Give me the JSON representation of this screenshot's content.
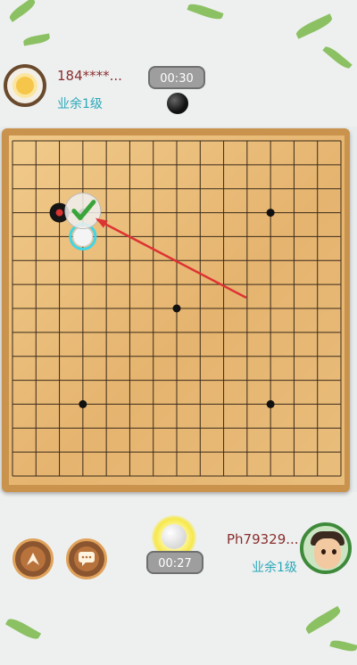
{
  "top_player": {
    "name": "184****...",
    "level": "业余1级",
    "timer": "00:30",
    "stone": "black"
  },
  "bottom_player": {
    "name": "Ph79329...",
    "level": "业余1级",
    "timer": "00:27",
    "stone": "white"
  },
  "board": {
    "size": 15,
    "star_points": [
      [
        3,
        3
      ],
      [
        3,
        11
      ],
      [
        7,
        7
      ],
      [
        11,
        3
      ],
      [
        11,
        11
      ]
    ],
    "stones": [
      {
        "color": "black",
        "col": 2,
        "row": 3
      },
      {
        "color": "white",
        "col": 3,
        "row": 4
      }
    ],
    "move_hint": "check-mark"
  },
  "colors": {
    "accent_red": "#d33",
    "check_green": "#3aa53a",
    "level_text": "#2aa8b8",
    "name_text": "#8a2e2e"
  },
  "icons": {
    "chat": "speech-bubble-icon",
    "up": "arrow-up-icon"
  }
}
